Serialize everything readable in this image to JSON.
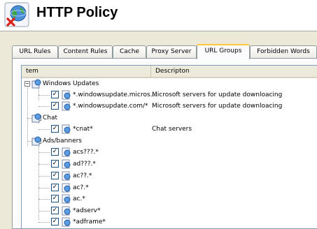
{
  "header": {
    "title": "HTTP Policy",
    "logo_icon": "globe-with-red-x-icon"
  },
  "tabs": [
    {
      "label": "URL Rules",
      "active": false
    },
    {
      "label": "Content Rules",
      "active": false
    },
    {
      "label": "Cache",
      "active": false
    },
    {
      "label": "Proxy Server",
      "active": false
    },
    {
      "label": "URL Groups",
      "active": true
    },
    {
      "label": "Forbidden Words",
      "active": false
    }
  ],
  "list": {
    "columns": [
      "tem",
      "Descripton"
    ],
    "groups": [
      {
        "name": "Windows Updates",
        "expanded": true,
        "items": [
          {
            "url": "*.windowsupdate.micros...",
            "desc": "Microsoft servers for update downloacing",
            "checked": true
          },
          {
            "url": "*.windowsupdate.com/*",
            "desc": "Microsoft servers for update downloacing",
            "checked": true
          }
        ]
      },
      {
        "name": "Chat",
        "expanded": true,
        "items": [
          {
            "url": "*cnat*",
            "desc": "Chat servers",
            "checked": true
          }
        ]
      },
      {
        "name": "Ads/banners",
        "expanded": true,
        "items": [
          {
            "url": "acs???.*",
            "desc": "",
            "checked": true
          },
          {
            "url": "ad???.*",
            "desc": "",
            "checked": true
          },
          {
            "url": "ac??.*",
            "desc": "",
            "checked": true
          },
          {
            "url": "ac?.*",
            "desc": "",
            "checked": true
          },
          {
            "url": "ac.*",
            "desc": "",
            "checked": true
          },
          {
            "url": "*adserv*",
            "desc": "",
            "checked": true
          },
          {
            "url": "*adframe*",
            "desc": "",
            "checked": true
          }
        ]
      }
    ]
  },
  "colors": {
    "window_bg": "#ece9d8",
    "active_tab_accent": "#ffc83c",
    "list_border": "#7f9db9"
  }
}
